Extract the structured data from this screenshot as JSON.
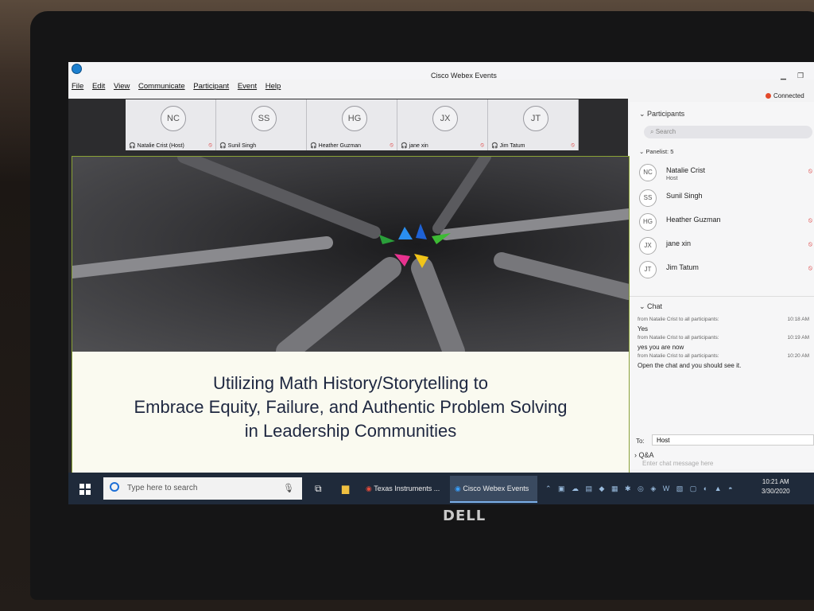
{
  "window": {
    "title": "Cisco Webex Events",
    "status": "Connected"
  },
  "menu": [
    "File",
    "Edit",
    "View",
    "Communicate",
    "Participant",
    "Event",
    "Help"
  ],
  "video_tiles": [
    {
      "initials": "NC",
      "name": "Natalie Crist (Host)"
    },
    {
      "initials": "SS",
      "name": "Sunil Singh"
    },
    {
      "initials": "HG",
      "name": "Heather Guzman"
    },
    {
      "initials": "JX",
      "name": "jane xin"
    },
    {
      "initials": "JT",
      "name": "Jim Tatum"
    }
  ],
  "slide": {
    "title_lines": [
      "Utilizing Math History/Storytelling to",
      "Embrace Equity, Failure, and Authentic Problem Solving",
      "in Leadership Communities"
    ]
  },
  "participants_panel": {
    "header": "Participants",
    "search_placeholder": "Search",
    "section_label": "Panelist: 5",
    "items": [
      {
        "initials": "NC",
        "name": "Natalie Crist",
        "role": "Host"
      },
      {
        "initials": "SS",
        "name": "Sunil Singh",
        "role": ""
      },
      {
        "initials": "HG",
        "name": "Heather Guzman",
        "role": ""
      },
      {
        "initials": "JX",
        "name": "jane xin",
        "role": ""
      },
      {
        "initials": "JT",
        "name": "Jim Tatum",
        "role": ""
      }
    ]
  },
  "chat": {
    "header": "Chat",
    "messages": [
      {
        "from": "from Natalie Crist to all participants:",
        "time": "10:18 AM",
        "text": "Yes"
      },
      {
        "from": "from Natalie Crist to all participants:",
        "time": "10:19 AM",
        "text": "yes you are now"
      },
      {
        "from": "from Natalie Crist to all participants:",
        "time": "10:20 AM",
        "text": "Open the chat and you should see it."
      }
    ],
    "to_label": "To:",
    "to_value": "Host",
    "input_placeholder": "Enter chat message here"
  },
  "qa": {
    "header": "Q&A"
  },
  "taskbar": {
    "search_placeholder": "Type here to search",
    "apps": [
      "Texas Instruments ...",
      "Cisco Webex Events"
    ],
    "time": "10:21 AM",
    "date": "3/30/2020"
  },
  "brand": "DELL"
}
